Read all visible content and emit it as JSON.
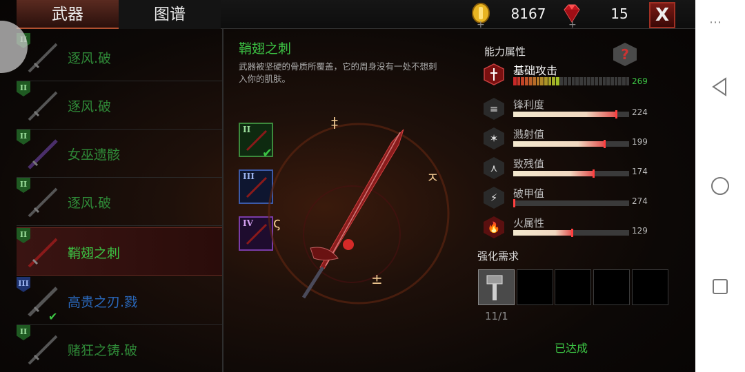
{
  "tabs": {
    "weapons": "武器",
    "atlas": "图谱"
  },
  "currency": {
    "gold": "8167",
    "gems": "15",
    "close_label": "X"
  },
  "weapon_list": [
    {
      "tier": "II",
      "name": "逐风.破",
      "color": "green"
    },
    {
      "tier": "II",
      "name": "逐风.破",
      "color": "green"
    },
    {
      "tier": "II",
      "name": "女巫遗骸",
      "color": "green"
    },
    {
      "tier": "II",
      "name": "逐风.破",
      "color": "green"
    },
    {
      "tier": "II",
      "name": "鞘翅之刺",
      "color": "bright"
    },
    {
      "tier": "III",
      "name": "高贵之刃.戮",
      "color": "blue"
    },
    {
      "tier": "II",
      "name": "赌狂之铸.破",
      "color": "green"
    }
  ],
  "detail": {
    "title": "鞘翅之刺",
    "description": "武器被坚硬的骨质所覆盖，它的周身没有一处不想刺入你的肌肤。",
    "tiers": [
      "II",
      "III",
      "IV"
    ]
  },
  "stats": {
    "title": "能力属性",
    "help": "?",
    "attack": {
      "name": "基础攻击",
      "value": "269",
      "segments_filled": 12,
      "segments_total": 30
    },
    "items": [
      {
        "name": "锋利度",
        "value": "224",
        "fill": 0.9
      },
      {
        "name": "溅射值",
        "value": "199",
        "fill": 0.8
      },
      {
        "name": "致残值",
        "value": "174",
        "fill": 0.7
      },
      {
        "name": "破甲值",
        "value": "274",
        "fill": 0.02
      },
      {
        "name": "火属性",
        "value": "129",
        "fill": 0.52
      }
    ]
  },
  "upgrade": {
    "title": "强化需求",
    "count": "11/1",
    "status": "已达成"
  },
  "colors": {
    "accent_green": "#3cc444",
    "tier_blue": "#2a6abf",
    "danger_red": "#e04848"
  }
}
